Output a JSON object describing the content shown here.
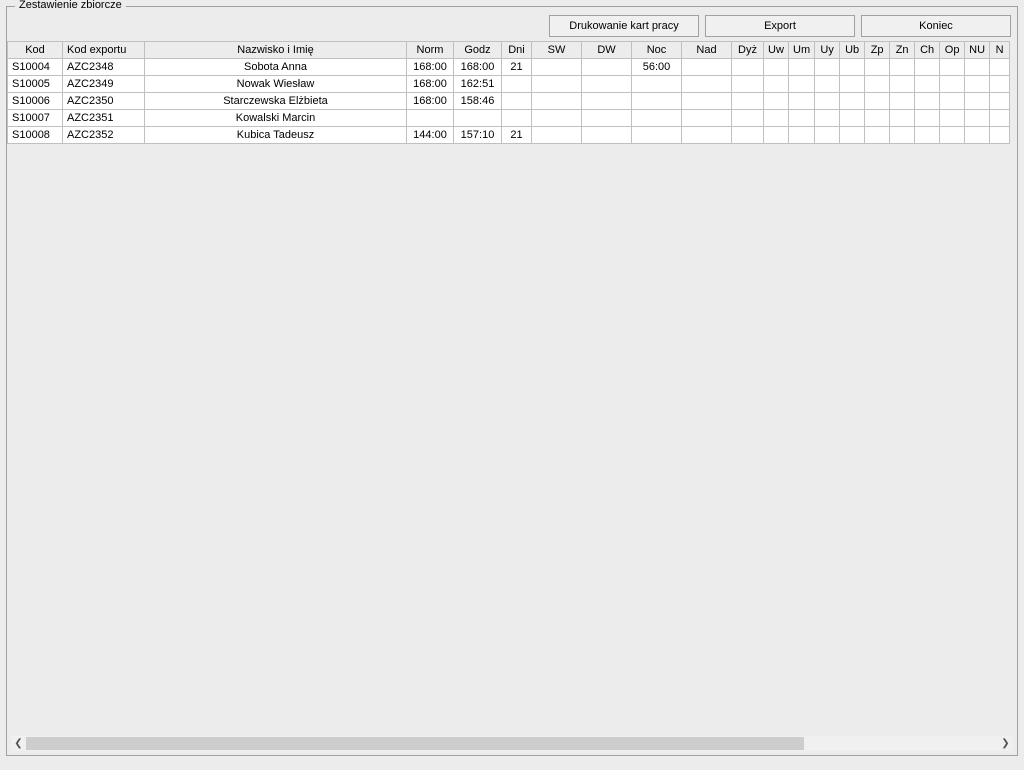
{
  "panel": {
    "title": "Zestawienie zbiorcze"
  },
  "toolbar": {
    "print": "Drukowanie kart pracy",
    "export": "Export",
    "close": "Koniec"
  },
  "columns": {
    "kod": "Kod",
    "export": "Kod exportu",
    "name": "Nazwisko i Imię",
    "norm": "Norm",
    "godz": "Godz",
    "dni": "Dni",
    "sw": "SW",
    "dw": "DW",
    "noc": "Noc",
    "nad": "Nad",
    "dyz": "Dyż",
    "uw": "Uw",
    "um": "Um",
    "uy": "Uy",
    "ub": "Ub",
    "zp": "Zp",
    "zn": "Zn",
    "ch": "Ch",
    "op": "Op",
    "nu": "NU",
    "n": "N"
  },
  "rows": [
    {
      "kod": "S10004",
      "export": "AZC2348",
      "name": "Sobota Anna",
      "norm": "168:00",
      "godz": "168:00",
      "dni": "21",
      "sw": "",
      "dw": "",
      "noc": "56:00",
      "nad": "",
      "dyz": "",
      "uw": "",
      "um": "",
      "uy": "",
      "ub": "",
      "zp": "",
      "zn": "",
      "ch": "",
      "op": "",
      "nu": "",
      "n": ""
    },
    {
      "kod": "S10005",
      "export": "AZC2349",
      "name": "Nowak Wiesław",
      "norm": "168:00",
      "godz": "162:51",
      "dni": "",
      "sw": "",
      "dw": "",
      "noc": "",
      "nad": "",
      "dyz": "",
      "uw": "",
      "um": "",
      "uy": "",
      "ub": "",
      "zp": "",
      "zn": "",
      "ch": "",
      "op": "",
      "nu": "",
      "n": ""
    },
    {
      "kod": "S10006",
      "export": "AZC2350",
      "name": "Starczewska Elżbieta",
      "norm": "168:00",
      "godz": "158:46",
      "dni": "",
      "sw": "",
      "dw": "",
      "noc": "",
      "nad": "",
      "dyz": "",
      "uw": "",
      "um": "",
      "uy": "",
      "ub": "",
      "zp": "",
      "zn": "",
      "ch": "",
      "op": "",
      "nu": "",
      "n": ""
    },
    {
      "kod": "S10007",
      "export": "AZC2351",
      "name": "Kowalski Marcin",
      "norm": "",
      "godz": "",
      "dni": "",
      "sw": "",
      "dw": "",
      "noc": "",
      "nad": "",
      "dyz": "",
      "uw": "",
      "um": "",
      "uy": "",
      "ub": "",
      "zp": "",
      "zn": "",
      "ch": "",
      "op": "",
      "nu": "",
      "n": ""
    },
    {
      "kod": "S10008",
      "export": "AZC2352",
      "name": "Kubica Tadeusz",
      "norm": "144:00",
      "godz": "157:10",
      "dni": "21",
      "sw": "",
      "dw": "",
      "noc": "",
      "nad": "",
      "dyz": "",
      "uw": "",
      "um": "",
      "uy": "",
      "ub": "",
      "zp": "",
      "zn": "",
      "ch": "",
      "op": "",
      "nu": "",
      "n": ""
    }
  ]
}
